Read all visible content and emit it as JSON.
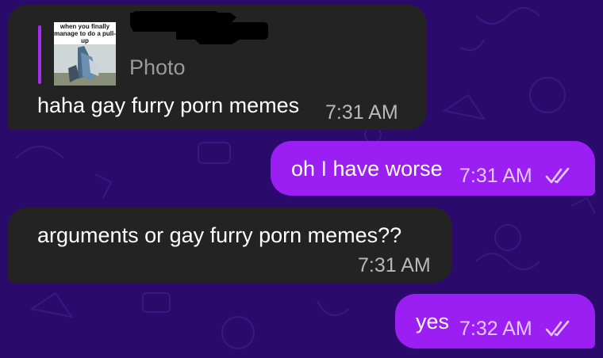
{
  "chat": {
    "messages": [
      {
        "direction": "incoming",
        "reply": {
          "thumbnail_caption": "when you finally manage to do a pull-up",
          "sender_redacted": true,
          "type_label": "Photo"
        },
        "text": "haha gay furry porn memes",
        "time": "7:31 AM"
      },
      {
        "direction": "outgoing",
        "text": "oh I have worse",
        "time": "7:31 AM",
        "status_icon": "double-check-icon"
      },
      {
        "direction": "incoming",
        "text": "arguments or gay furry porn memes??",
        "time": "7:31 AM"
      },
      {
        "direction": "outgoing",
        "text": "yes",
        "time": "7:32 AM",
        "status_icon": "double-check-icon"
      }
    ]
  },
  "colors": {
    "wallpaper": "#2a0a6b",
    "incoming_bubble": "#232323",
    "outgoing_bubble": "#9b1ff3",
    "reply_accent": "#a52df2"
  }
}
